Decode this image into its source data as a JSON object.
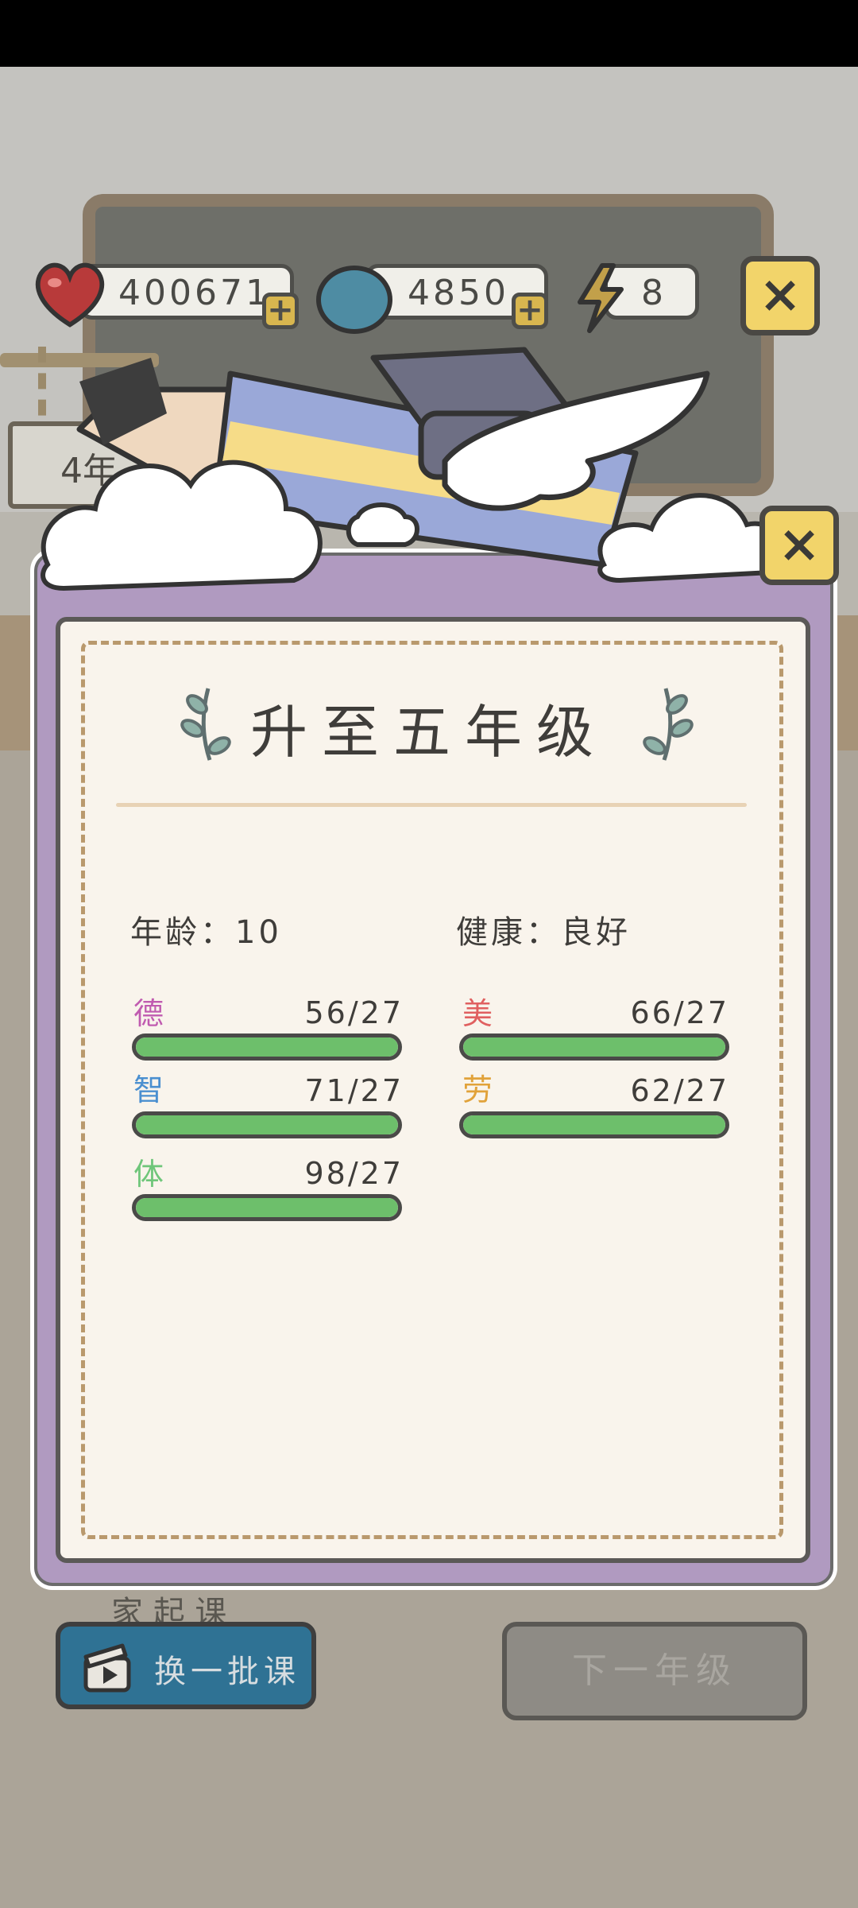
{
  "resources": {
    "hearts": "400671",
    "gems": "4850",
    "energy": "8",
    "plus": "+"
  },
  "background": {
    "board_sign": "4年"
  },
  "modal": {
    "title": "升至五年级",
    "close": "×",
    "age": "年龄：10",
    "health": "健康：良好",
    "stats": [
      {
        "label": "德",
        "value": "56/27",
        "color": "#c05bb0",
        "fill": 1.0
      },
      {
        "label": "智",
        "value": "71/27",
        "color": "#4a8fd0",
        "fill": 1.0
      },
      {
        "label": "体",
        "value": "98/27",
        "color": "#6fc67a",
        "fill": 1.0
      },
      {
        "label": "美",
        "value": "66/27",
        "color": "#e06060",
        "fill": 1.0
      },
      {
        "label": "劳",
        "value": "62/27",
        "color": "#e1a23a",
        "fill": 1.0
      }
    ]
  },
  "buttons": {
    "change_courses": "换一批课",
    "next_grade": "下一年级",
    "top_close": "×"
  },
  "peek": "家 起 课"
}
